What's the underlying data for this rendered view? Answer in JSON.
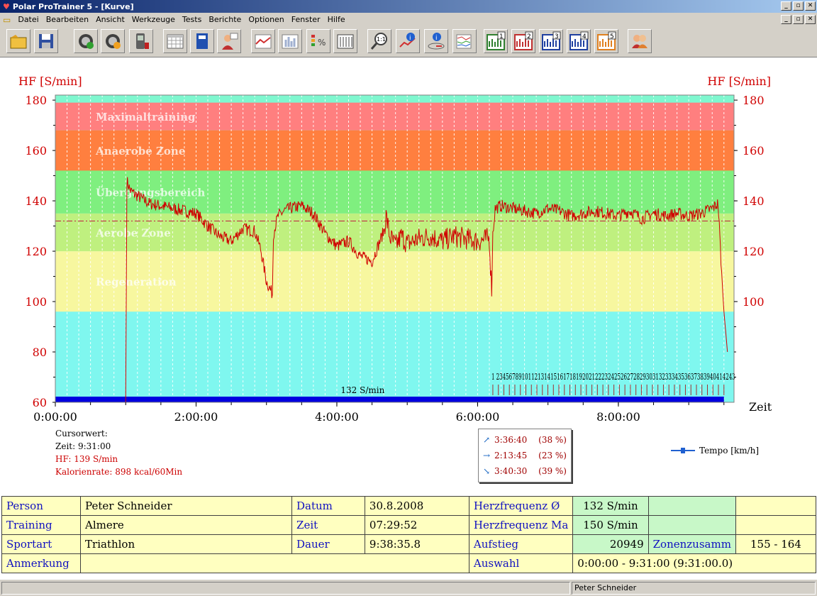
{
  "window": {
    "title": "Polar ProTrainer 5 - [Kurve]",
    "min": "_",
    "max": "▫",
    "close": "✕"
  },
  "menu": [
    "Datei",
    "Bearbeiten",
    "Ansicht",
    "Werkzeuge",
    "Tests",
    "Berichte",
    "Optionen",
    "Fenster",
    "Hilfe"
  ],
  "toolbar": [
    {
      "name": "open-folder-icon"
    },
    {
      "name": "save-icon"
    },
    {
      "name": "sync-watch-icon"
    },
    {
      "name": "watch-settings-icon"
    },
    {
      "name": "transfer-device-icon"
    },
    {
      "name": "calendar-icon"
    },
    {
      "name": "diary-book-icon"
    },
    {
      "name": "person-info-icon"
    },
    {
      "name": "curve-view-icon"
    },
    {
      "name": "bar-view-icon"
    },
    {
      "name": "percent-zones-icon"
    },
    {
      "name": "table-view-icon"
    },
    {
      "name": "zoom-1to1-icon",
      "label": "1:1"
    },
    {
      "name": "info-curve-icon"
    },
    {
      "name": "info-lap-icon"
    },
    {
      "name": "curve-options-icon"
    },
    {
      "name": "graph-1-icon",
      "label": "1"
    },
    {
      "name": "graph-2-icon",
      "label": "2"
    },
    {
      "name": "graph-3-icon",
      "label": "3"
    },
    {
      "name": "graph-4-icon",
      "label": "4"
    },
    {
      "name": "graph-5-icon",
      "label": "5"
    },
    {
      "name": "users-icon"
    }
  ],
  "chart_data": {
    "type": "line",
    "ylabel_left": "HF [S/min]",
    "ylabel_right": "HF [S/min]",
    "xlabel": "Zeit",
    "ylim": [
      60,
      182
    ],
    "y_ticks": [
      60,
      80,
      100,
      120,
      140,
      160,
      180
    ],
    "y_ticks_right": [
      100,
      120,
      140,
      160,
      180
    ],
    "xlim": [
      "0:00:00",
      "9:38:35"
    ],
    "x_ticks": [
      "0:00:00",
      "2:00:00",
      "4:00:00",
      "6:00:00",
      "8:00:00"
    ],
    "zones": [
      {
        "name": "Maximaltraining",
        "from": 168,
        "to": 179,
        "color": "#ff7f7f"
      },
      {
        "name": "Anaerobe Zone",
        "from": 152,
        "to": 168,
        "color": "#ff7f3f"
      },
      {
        "name": "Übergangsbereich",
        "from": 135,
        "to": 152,
        "color": "#7fef7f"
      },
      {
        "name": "Aerobe Zone",
        "from": 120,
        "to": 135,
        "color": "#bff07f"
      },
      {
        "name": "Regeneration",
        "from": 96,
        "to": 120,
        "color": "#f7f79f"
      }
    ],
    "below_zone_color": "#7ff7ef",
    "average_line": {
      "value": 132,
      "label": "132 S/min"
    },
    "series": [
      {
        "name": "HF",
        "color": "#d00000",
        "x_minutes": [
          0,
          60,
          61,
          64,
          70,
          80,
          90,
          100,
          110,
          120,
          130,
          140,
          150,
          160,
          170,
          175,
          180,
          185,
          186,
          188,
          190,
          195,
          200,
          210,
          220,
          230,
          240,
          250,
          260,
          270,
          280,
          282,
          285,
          290,
          295,
          300,
          310,
          320,
          330,
          340,
          350,
          360,
          370,
          372,
          373,
          375,
          380,
          390,
          400,
          410,
          420,
          430,
          440,
          450,
          460,
          470,
          480,
          490,
          500,
          510,
          520,
          530,
          540,
          550,
          560,
          565,
          568,
          570,
          573
        ],
        "y": [
          60,
          60,
          148,
          144,
          142,
          139,
          138,
          137,
          136,
          135,
          130,
          126,
          124,
          129,
          128,
          121,
          108,
          103,
          127,
          131,
          134,
          136,
          137,
          138,
          135,
          127,
          122,
          124,
          118,
          116,
          128,
          134,
          126,
          122,
          126,
          123,
          125,
          126,
          124,
          126,
          125,
          124,
          125,
          104,
          127,
          137,
          138,
          137,
          136,
          135,
          137,
          136,
          134,
          135,
          136,
          135,
          134,
          136,
          133,
          135,
          134,
          135,
          134,
          135,
          137,
          139,
          112,
          96,
          80
        ]
      }
    ],
    "lap_markers_label": "1 234567891011213141516171819202122232425262728293031323334353637383940414243",
    "lap_markers_start_minute": 373,
    "lap_markers_end_minute": 570
  },
  "cursor": {
    "title": "Cursorwert:",
    "zeit": "Zeit: 9:31:00",
    "hf": "HF: 139 S/min",
    "kal": "Kalorienrate: 898 kcal/60Min"
  },
  "stats": [
    {
      "arrow": "↗",
      "time": "3:36:40",
      "pct": "(38 %)"
    },
    {
      "arrow": "→",
      "time": "2:13:45",
      "pct": "(23 %)"
    },
    {
      "arrow": "↘",
      "time": "3:40:30",
      "pct": "(39 %)"
    }
  ],
  "legend": {
    "tempo": "Tempo [km/h]"
  },
  "info": {
    "person_lbl": "Person",
    "person": "Peter Schneider",
    "training_lbl": "Training",
    "training": "Almere",
    "sportart_lbl": "Sportart",
    "sportart": "Triathlon",
    "anmerkung_lbl": "Anmerkung",
    "datum_lbl": "Datum",
    "datum": "30.8.2008",
    "zeit_lbl": "Zeit",
    "zeit": "07:29:52",
    "dauer_lbl": "Dauer",
    "dauer": "9:38:35.8",
    "hf_avg_lbl": "Herzfrequenz Ø",
    "hf_avg": "132 S/min",
    "hf_max_lbl": "Herzfrequenz Ma",
    "hf_max": "150 S/min",
    "aufstieg_lbl": "Aufstieg",
    "aufstieg": "20949",
    "zonen_lbl": "Zonenzusamm",
    "zonen": "155 - 164",
    "auswahl_lbl": "Auswahl",
    "auswahl": "0:00:00 - 9:31:00 (9:31:00.0)"
  },
  "status": {
    "user": "Peter Schneider"
  }
}
